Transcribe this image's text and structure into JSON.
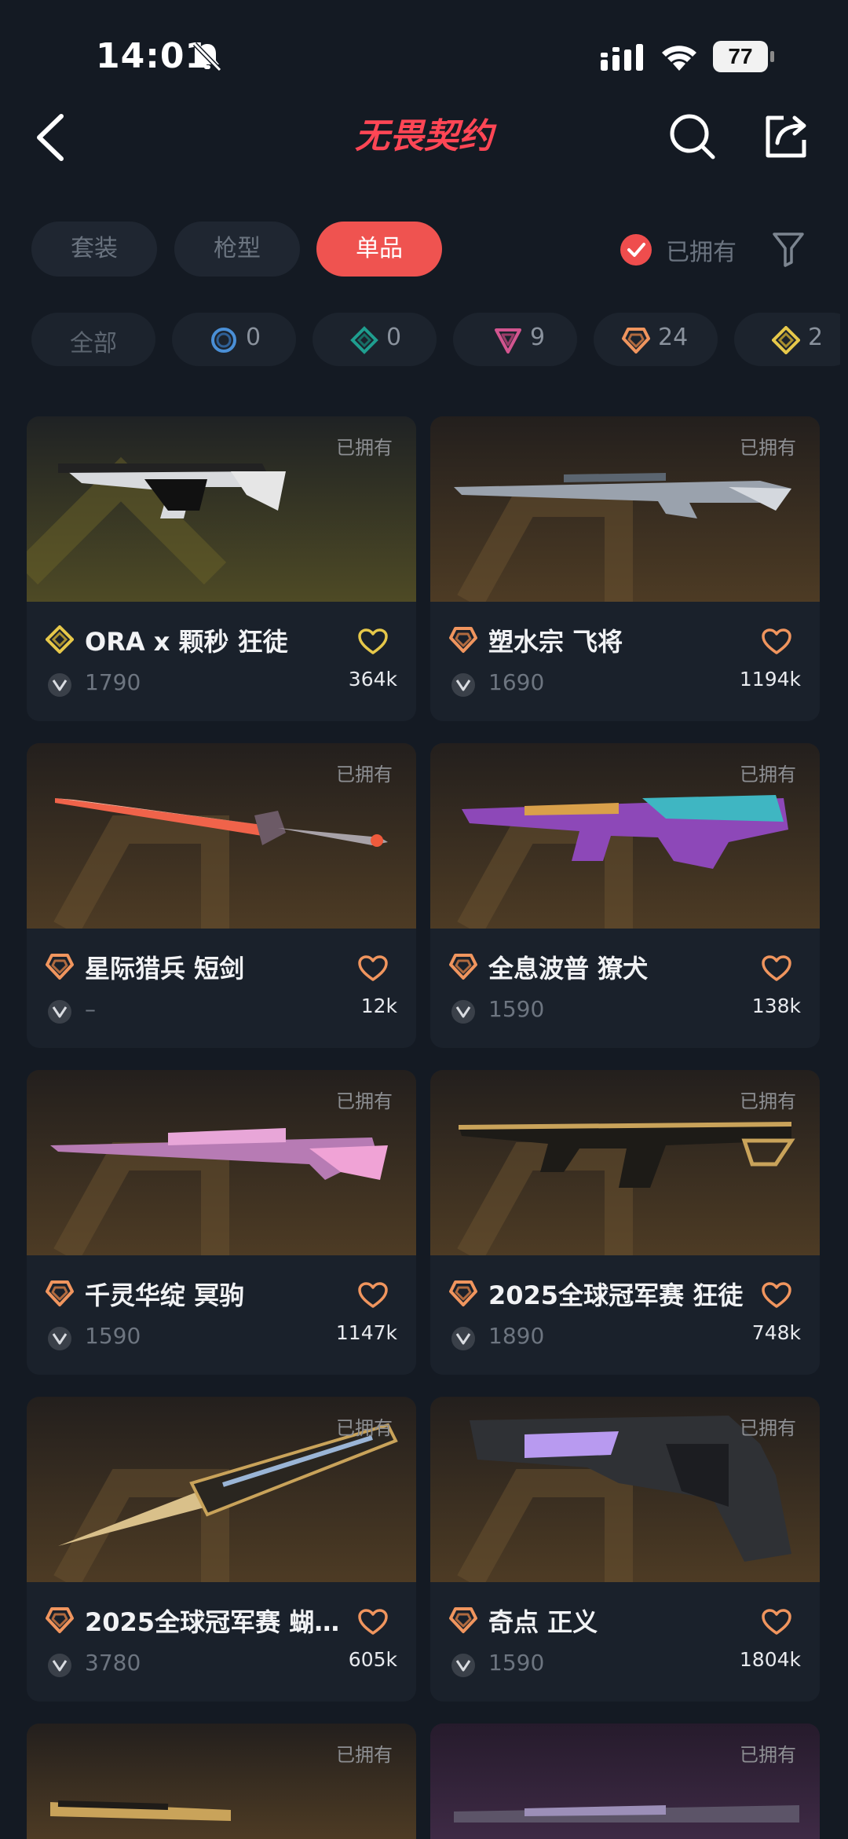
{
  "status_bar": {
    "time": "14:01",
    "battery": "77"
  },
  "nav": {
    "title": "无畏契约"
  },
  "tabs": [
    {
      "label": "套装",
      "active": false
    },
    {
      "label": "枪型",
      "active": false
    },
    {
      "label": "单品",
      "active": true
    }
  ],
  "owned_filter": {
    "label": "已拥有",
    "checked": true
  },
  "rarity_chips": [
    {
      "label": "全部"
    },
    {
      "tier": "select",
      "count": "0"
    },
    {
      "tier": "deluxe",
      "count": "0"
    },
    {
      "tier": "premium",
      "count": "9"
    },
    {
      "tier": "exclusive",
      "count": "24"
    },
    {
      "tier": "ultra",
      "count": "2"
    }
  ],
  "skins": [
    {
      "owned": "已拥有",
      "name": "ORA x 颗秒 狂徒",
      "price": "1790",
      "likes": "364k",
      "tier": "ultra",
      "bg": "olive"
    },
    {
      "owned": "已拥有",
      "name": "塑水宗 飞将",
      "price": "1690",
      "likes": "1194k",
      "tier": "exclusive",
      "bg": "gold"
    },
    {
      "owned": "已拥有",
      "name": "星际猎兵 短剑",
      "price": "–",
      "likes": "12k",
      "tier": "exclusive",
      "bg": "gold"
    },
    {
      "owned": "已拥有",
      "name": "全息波普 獠犬",
      "price": "1590",
      "likes": "138k",
      "tier": "exclusive",
      "bg": "gold"
    },
    {
      "owned": "已拥有",
      "name": "千灵华绽 冥驹",
      "price": "1590",
      "likes": "1147k",
      "tier": "exclusive",
      "bg": "gold"
    },
    {
      "owned": "已拥有",
      "name": "2025全球冠军赛 狂徒",
      "price": "1890",
      "likes": "748k",
      "tier": "exclusive",
      "bg": "gold"
    },
    {
      "owned": "已拥有",
      "name": "2025全球冠军赛 蝴…",
      "price": "3780",
      "likes": "605k",
      "tier": "exclusive",
      "bg": "gold"
    },
    {
      "owned": "已拥有",
      "name": "奇点 正义",
      "price": "1590",
      "likes": "1804k",
      "tier": "exclusive",
      "bg": "gold"
    },
    {
      "owned": "已拥有",
      "bg": "gold"
    },
    {
      "owned": "已拥有",
      "bg": "purple"
    }
  ],
  "colors": {
    "accent": "#ef5350",
    "ultra": "#e6c84a",
    "exclusive": "#f0955e",
    "premium": "#d2558f",
    "deluxe": "#1f9e8f",
    "select": "#4a8fd6",
    "heart": "#f0955e"
  }
}
